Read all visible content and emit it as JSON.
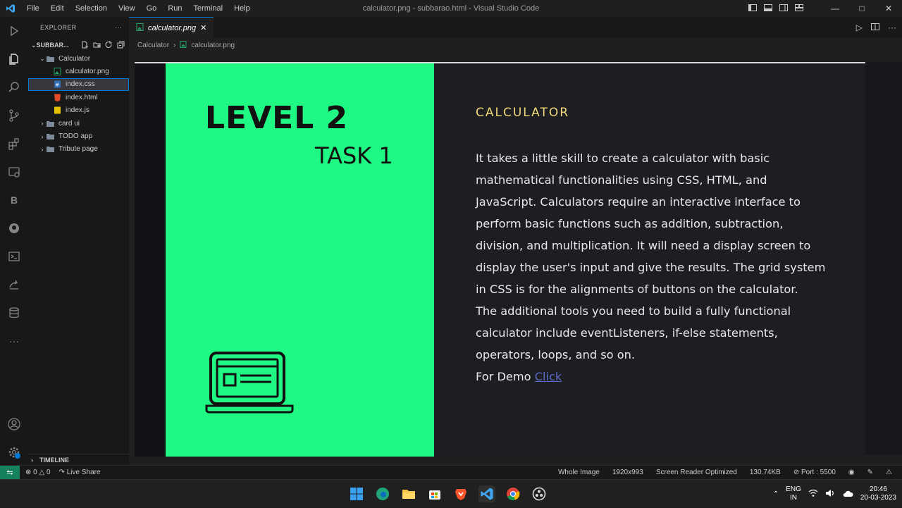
{
  "titlebar": {
    "menu": [
      "File",
      "Edit",
      "Selection",
      "View",
      "Go",
      "Run",
      "Terminal",
      "Help"
    ],
    "window_title": "calculator.png - subbarao.html - Visual Studio Code"
  },
  "explorer": {
    "header": "EXPLORER",
    "root": "SUBBAR...",
    "items": [
      {
        "label": "Calculator",
        "type": "folder-open",
        "indent": 1
      },
      {
        "label": "calculator.png",
        "type": "image",
        "indent": 2
      },
      {
        "label": "index.css",
        "type": "css",
        "indent": 2
      },
      {
        "label": "index.html",
        "type": "html",
        "indent": 2
      },
      {
        "label": "index.js",
        "type": "js",
        "indent": 2
      },
      {
        "label": "card ui",
        "type": "folder",
        "indent": 1
      },
      {
        "label": "TODO app",
        "type": "folder",
        "indent": 1
      },
      {
        "label": "Tribute page",
        "type": "folder",
        "indent": 1
      }
    ],
    "timeline": "TIMELINE"
  },
  "editor": {
    "tab_label": "calculator.png",
    "breadcrumb": [
      "Calculator",
      "calculator.png"
    ]
  },
  "slide": {
    "level": "LEVEL 2",
    "task": "TASK 1",
    "title": "CALCULATOR",
    "lines": [
      "It takes a little skill to create a calculator with basic",
      "mathematical functionalities using CSS, HTML, and",
      "JavaScript. Calculators require an interactive interface to",
      "perform basic functions such as addition, subtraction,",
      "division, and multiplication. It will need a  display screen to",
      "display the user's input and give the results. The grid system",
      "in CSS is for the alignments of buttons on the calculator.",
      "The additional tools you need to build a fully functional",
      "calculator include eventListeners, if-else statements,",
      "operators, loops, and so on."
    ],
    "demo_prefix": "For Demo ",
    "demo_link": "Click"
  },
  "statusbar": {
    "errors": "0",
    "warnings": "0",
    "live_share": "Live Share",
    "whole_image": "Whole Image",
    "dimensions": "1920x993",
    "screen_reader": "Screen Reader Optimized",
    "size": "130.74KB",
    "port": "Port : 5500"
  },
  "taskbar": {
    "lang_top": "ENG",
    "lang_bottom": "IN",
    "time": "20:46",
    "date": "20-03-2023"
  },
  "colors": {
    "accent": "#0078d4",
    "slide_green": "#1ff984",
    "slide_title": "#f1d87a",
    "link": "#5b6cc9"
  }
}
